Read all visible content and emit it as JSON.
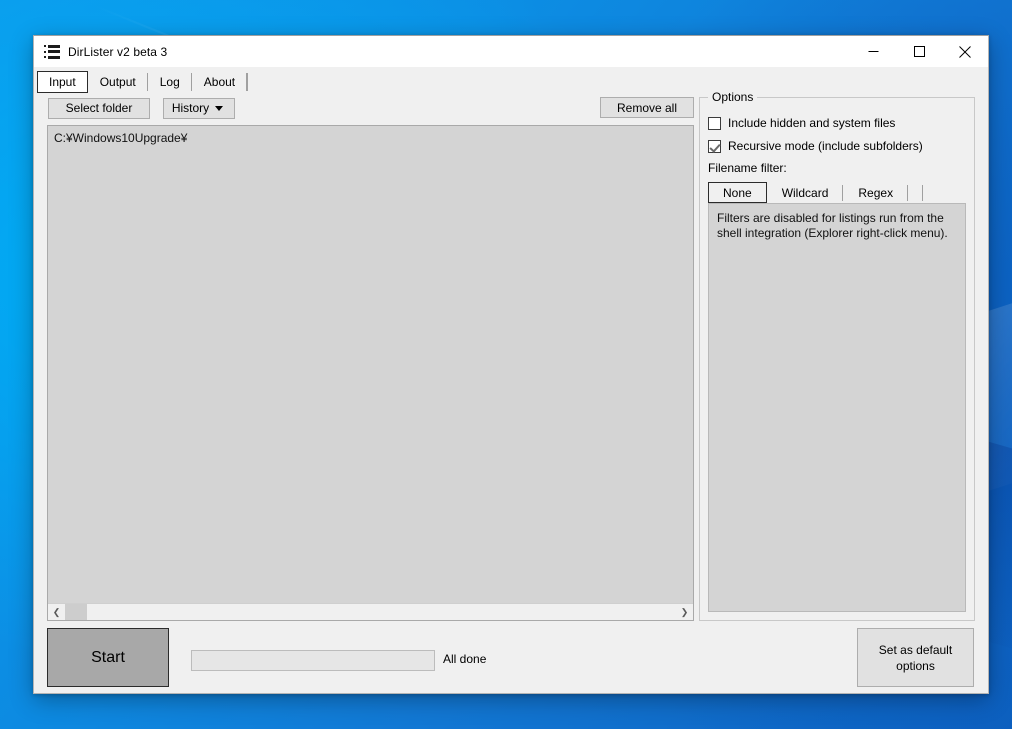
{
  "window": {
    "title": "DirLister v2 beta 3",
    "app_icon": "list-icon",
    "controls": {
      "minimize": "minimize-icon",
      "maximize": "maximize-icon",
      "close": "close-icon"
    }
  },
  "tabs": [
    {
      "label": "Input",
      "selected": true
    },
    {
      "label": "Output",
      "selected": false
    },
    {
      "label": "Log",
      "selected": false
    },
    {
      "label": "About",
      "selected": false
    }
  ],
  "input_tab": {
    "toolbar": {
      "select_folder_label": "Select folder",
      "history_label": "History",
      "history_caret": "chevron-down-icon",
      "remove_all_label": "Remove all"
    },
    "folder_list": {
      "items": [
        "C:¥Windows10Upgrade¥"
      ],
      "scrollbar": {
        "left_arrow": "chevron-left-icon",
        "right_arrow": "chevron-right-icon"
      }
    }
  },
  "options": {
    "group_label": "Options",
    "checkboxes": [
      {
        "label": "Include hidden and system files",
        "checked": false
      },
      {
        "label": "Recursive mode (include subfolders)",
        "checked": true
      }
    ],
    "filter_label": "Filename filter:",
    "filter_tabs": [
      {
        "label": "None",
        "selected": true
      },
      {
        "label": "Wildcard",
        "selected": false
      },
      {
        "label": "Regex",
        "selected": false
      }
    ],
    "filter_message": [
      "Filters are disabled for listings run from the",
      "shell integration (Explorer right-click menu)."
    ]
  },
  "footer": {
    "start_label": "Start",
    "progress_value": 0,
    "status_text": "All done",
    "default_options_line1": "Set as default",
    "default_options_line2": "options"
  },
  "colors": {
    "window_face": "#f0f0f0",
    "list_face": "#d4d4d4",
    "button_face": "#e1e1e1",
    "start_button_face": "#a8a8a8",
    "desktop_blue": "#0a7fd4"
  }
}
